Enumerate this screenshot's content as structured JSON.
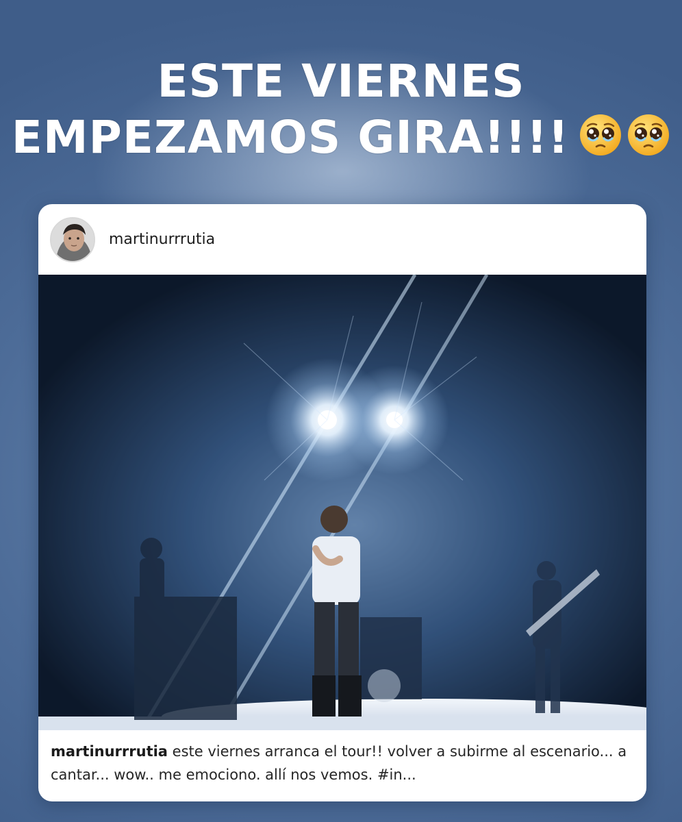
{
  "story": {
    "title_line1": "ESTE VIERNES",
    "title_line2": "EMPEZAMOS GIRA!!!!",
    "emojis": [
      "pleading-face-icon",
      "pleading-face-icon"
    ]
  },
  "post": {
    "username": "martinurrrutia",
    "caption_user": "martinurrrutia",
    "caption_text": " este viernes arranca el tour!! volver a subirme al escenario... a cantar... wow.. me emociono. allí nos vemos.  #in..."
  },
  "colors": {
    "background": "#52719d",
    "card": "#ffffff",
    "photo_stage_light": "#bfe0ff",
    "emoji_face": "#f7b42a"
  }
}
